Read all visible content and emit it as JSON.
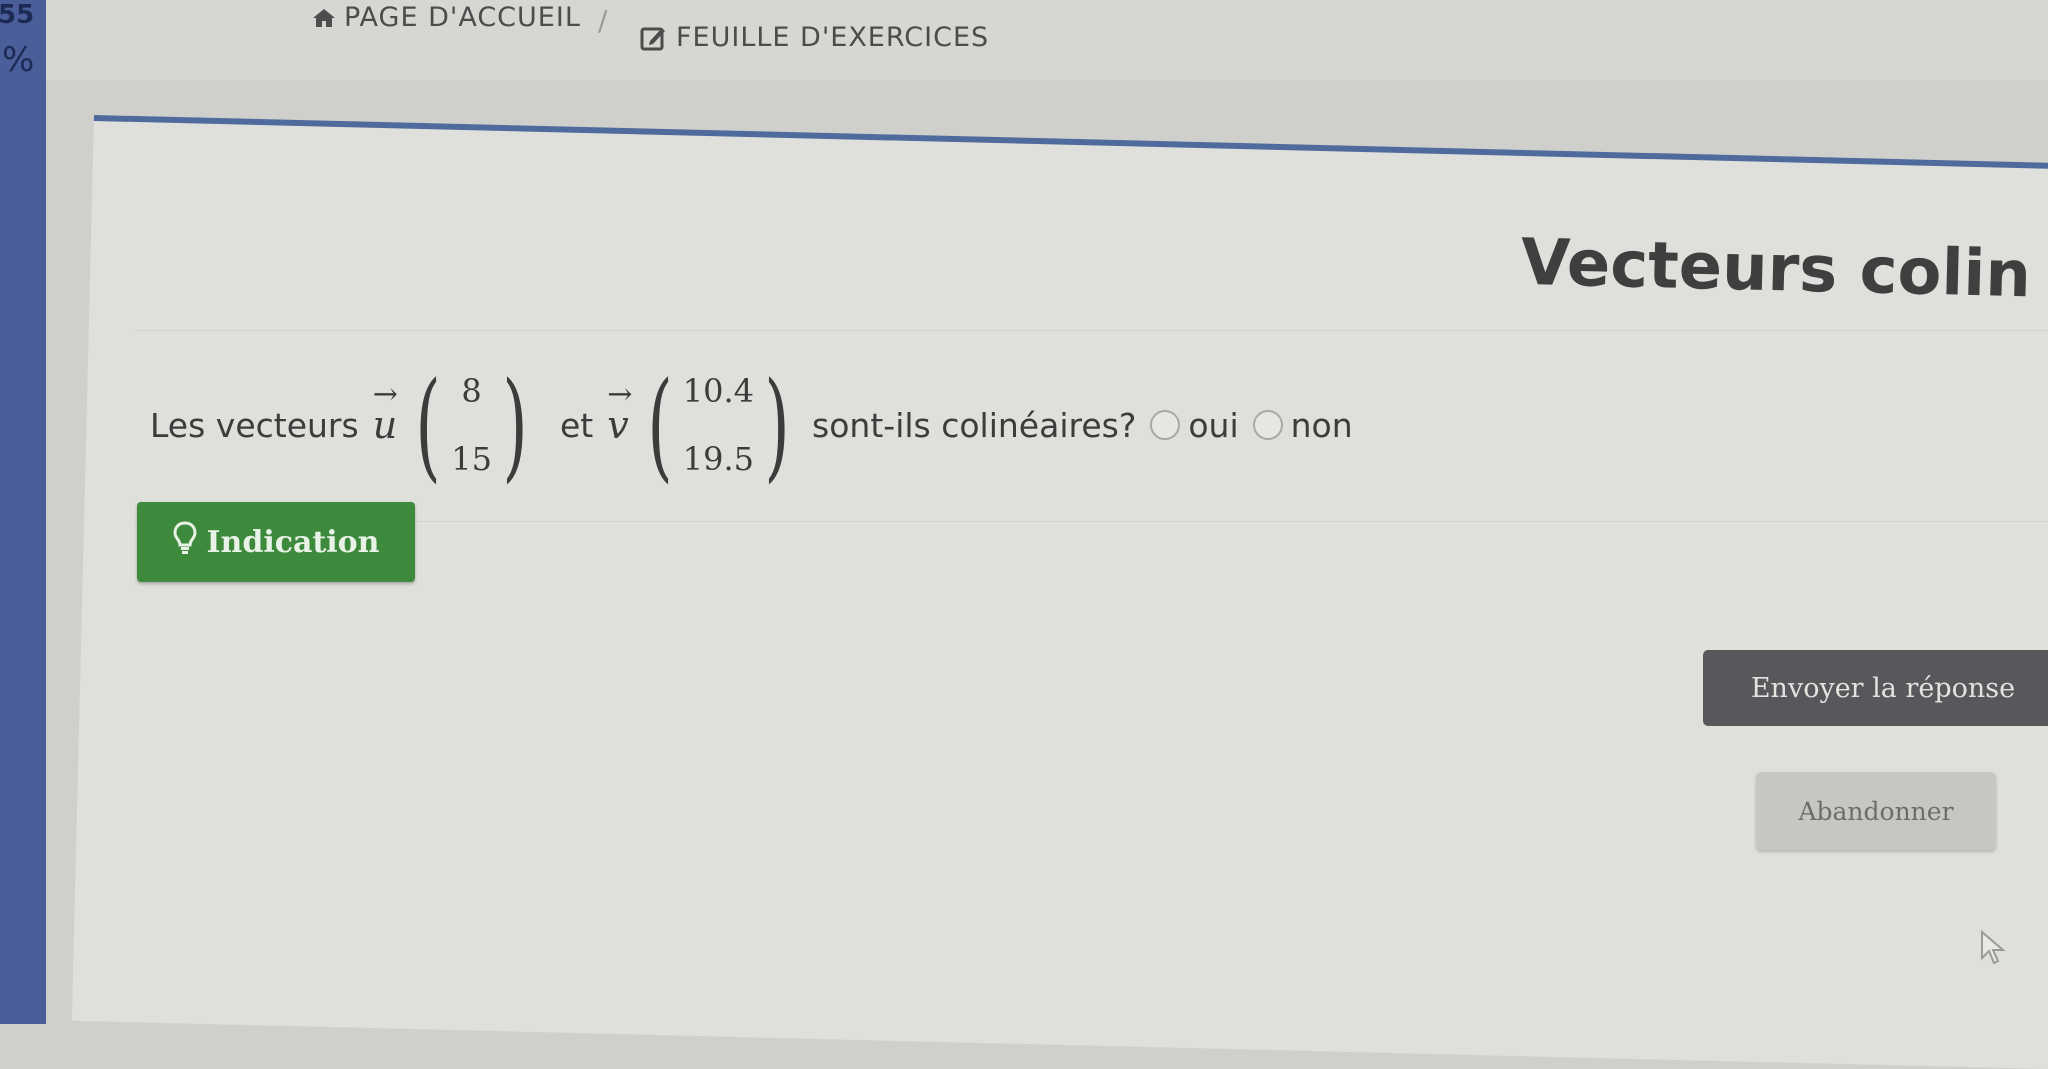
{
  "left_strip": {
    "number": "55",
    "symbol": "%"
  },
  "breadcrumb": {
    "home_icon": "home-icon",
    "home_label": "PAGE D'ACCUEIL",
    "separator": "/",
    "sheet_icon": "edit-icon",
    "sheet_label": "FEUILLE D'EXERCICES"
  },
  "exercise": {
    "title": "Vecteurs colin",
    "question_prefix": "Les vecteurs",
    "vector_u": {
      "name": "u",
      "x": "8",
      "y": "15"
    },
    "conjunction": "et",
    "vector_v": {
      "name": "v",
      "x": "10.4",
      "y": "19.5"
    },
    "question_suffix": "sont-ils colinéaires?",
    "options": [
      {
        "label": "oui"
      },
      {
        "label": "non"
      }
    ]
  },
  "buttons": {
    "hint_label": "Indication",
    "hint_icon": "lightbulb-icon",
    "submit_label": "Envoyer la réponse",
    "quit_label": "Abandonner"
  },
  "colors": {
    "accent": "#4f6a9c",
    "hint": "#3e8a3c",
    "submit": "#56585b"
  }
}
